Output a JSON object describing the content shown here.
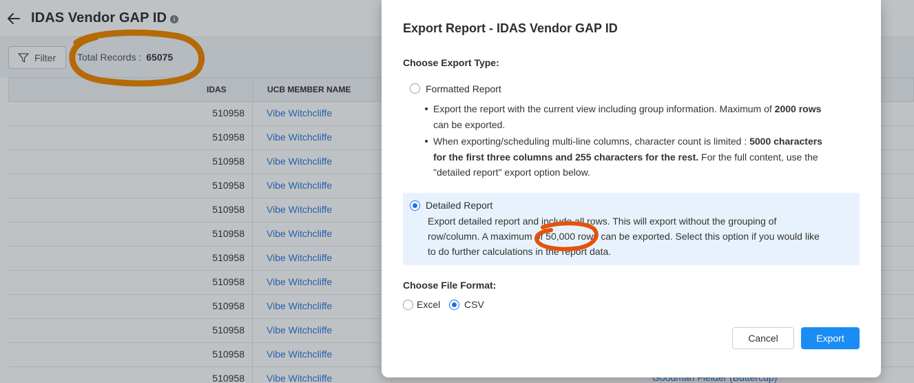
{
  "page": {
    "title": "IDAS Vendor GAP ID",
    "filter_label": "Filter",
    "records_label": "Total Records :",
    "records_count": "65075",
    "columns": [
      "IDAS",
      "UCB MEMBER NAME"
    ],
    "rows": [
      {
        "idas": "510958",
        "name": "Vibe Witchcliffe"
      },
      {
        "idas": "510958",
        "name": "Vibe Witchcliffe"
      },
      {
        "idas": "510958",
        "name": "Vibe Witchcliffe"
      },
      {
        "idas": "510958",
        "name": "Vibe Witchcliffe"
      },
      {
        "idas": "510958",
        "name": "Vibe Witchcliffe"
      },
      {
        "idas": "510958",
        "name": "Vibe Witchcliffe"
      },
      {
        "idas": "510958",
        "name": "Vibe Witchcliffe"
      },
      {
        "idas": "510958",
        "name": "Vibe Witchcliffe"
      },
      {
        "idas": "510958",
        "name": "Vibe Witchcliffe"
      },
      {
        "idas": "510958",
        "name": "Vibe Witchcliffe"
      },
      {
        "idas": "510958",
        "name": "Vibe Witchcliffe"
      },
      {
        "idas": "510958",
        "name": "Vibe Witchcliffe"
      }
    ],
    "partial_cell": "Goodman Fielder (Buttercup)"
  },
  "modal": {
    "title": "Export Report - IDAS Vendor GAP ID",
    "export_type_heading": "Choose Export Type:",
    "formatted": {
      "label": "Formatted Report",
      "selected": false,
      "bullet1_a": "Export the report with the current view including group information. Maximum of ",
      "bullet1_b": "2000 rows",
      "bullet1_c": "can be exported.",
      "bullet2_a": "When exporting/scheduling multi-line columns, character count is limited : ",
      "bullet2_b": "5000 characters",
      "bullet2_c": "for the first three columns and 255 characters for the rest.",
      "bullet2_d": " For the full content, use the",
      "bullet2_e": "\"detailed report\" export option below."
    },
    "detailed": {
      "label": "Detailed Report",
      "selected": true,
      "desc_1": "Export detailed report and include all rows. This will export without the grouping of",
      "desc_2": "row/column. A maximum of 50,000 rows can be exported. Select this option if you would like",
      "desc_3": "to do further calculations in the report data."
    },
    "file_format_heading": "Choose File Format:",
    "formats": [
      {
        "label": "Excel",
        "selected": false
      },
      {
        "label": "CSV",
        "selected": true
      }
    ],
    "cancel_label": "Cancel",
    "export_label": "Export"
  },
  "colors": {
    "accent": "#1a73e8",
    "export_button": "#1a8cf3",
    "link": "#2a78d8",
    "selected_option_bg": "#e8f2fc",
    "annotation_brown": "#b56a08",
    "annotation_orange": "#e4520c"
  }
}
